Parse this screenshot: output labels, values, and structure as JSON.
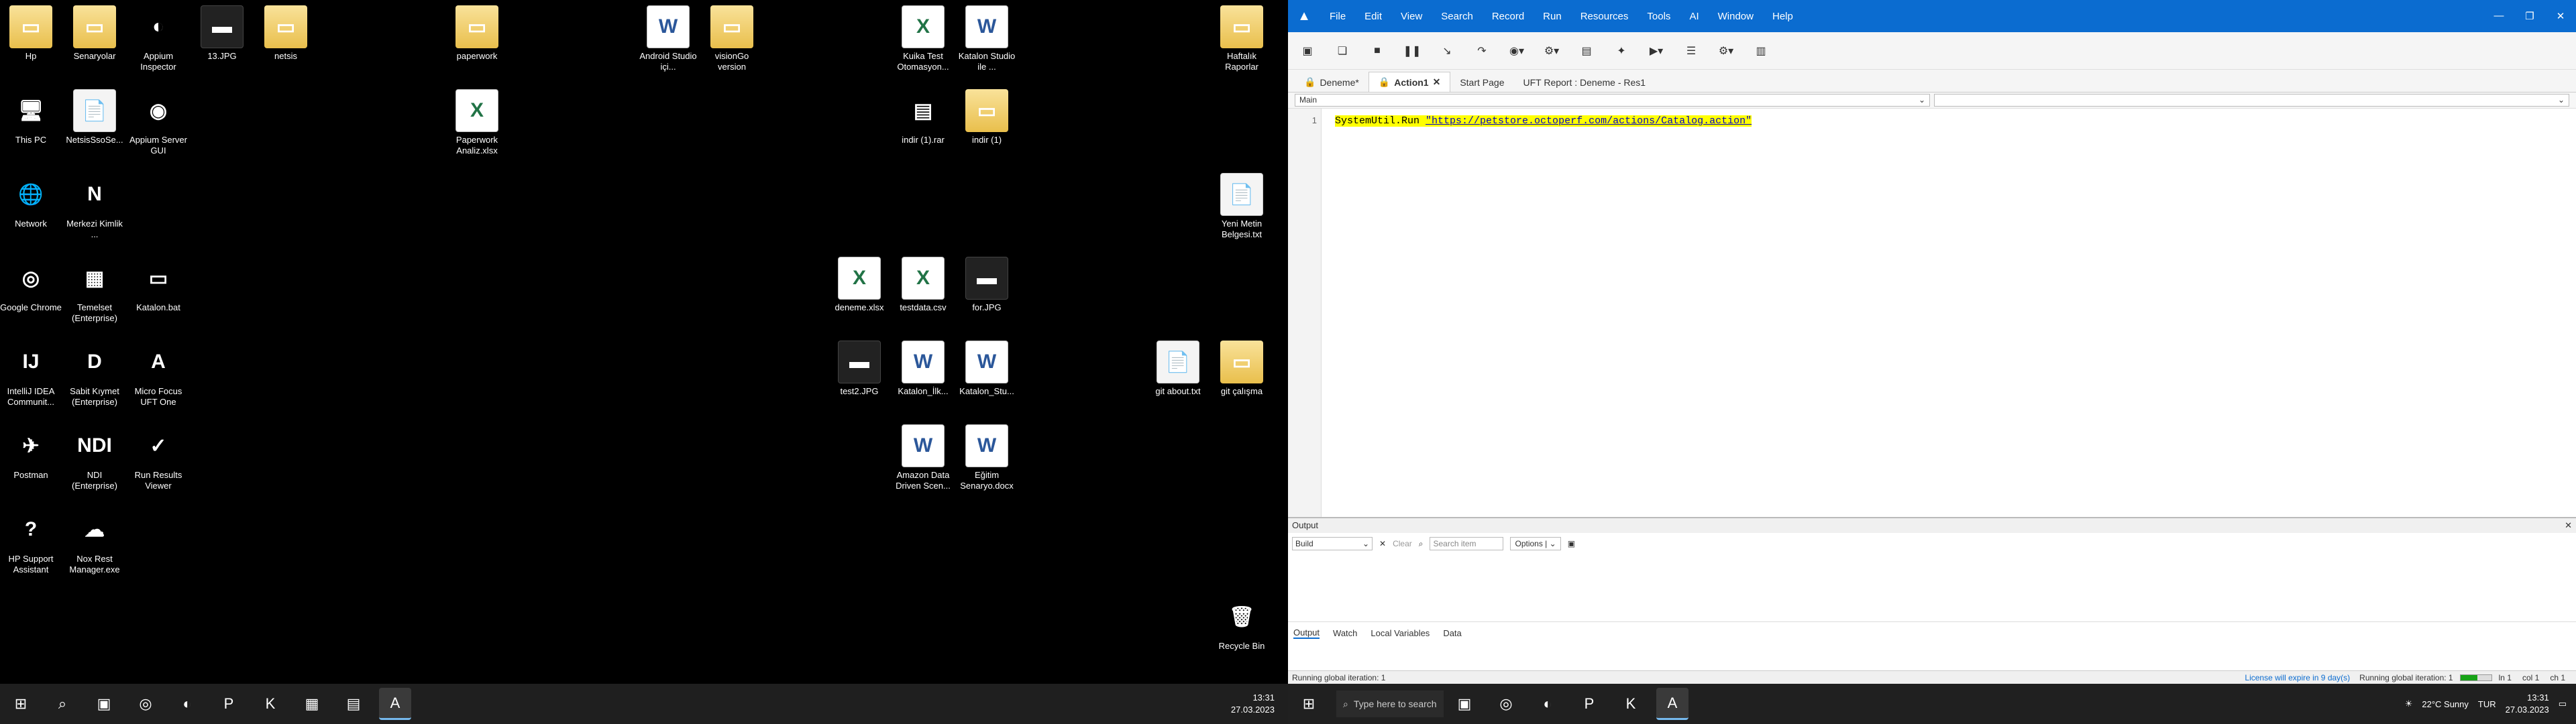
{
  "desktop_left": {
    "icons": [
      {
        "label": "Hp",
        "glyph": "▭"
      },
      {
        "label": "Senaryolar",
        "glyph": "▭"
      },
      {
        "label": "Appium Inspector",
        "glyph": "◐"
      },
      {
        "label": "13.JPG",
        "glyph": "▬"
      },
      {
        "label": "netsis",
        "glyph": "▭"
      },
      {
        "label": "paperwork",
        "glyph": "▭"
      },
      {
        "label": "Android Studio içi...",
        "glyph": "W"
      },
      {
        "label": "visionGo version",
        "glyph": "▭"
      },
      {
        "label": "Kuika Test Otomasyon...",
        "glyph": "X"
      },
      {
        "label": "Katalon Studio ile ...",
        "glyph": "W"
      },
      {
        "label": "Haftalık Raporlar",
        "glyph": "▭"
      },
      {
        "label": "This PC",
        "glyph": "🖥"
      },
      {
        "label": "NetsisSsoSe...",
        "glyph": "📄"
      },
      {
        "label": "Appium Server GUI",
        "glyph": "◉"
      },
      {
        "label": "Paperwork Analiz.xlsx",
        "glyph": "X"
      },
      {
        "label": "indir (1).rar",
        "glyph": "▤"
      },
      {
        "label": "indir (1)",
        "glyph": "▭"
      },
      {
        "label": "Network",
        "glyph": "🌐"
      },
      {
        "label": "Merkezi Kimlik ...",
        "glyph": "N"
      },
      {
        "label": "Yeni Metin Belgesi.txt",
        "glyph": "📄"
      },
      {
        "label": "Google Chrome",
        "glyph": "◎"
      },
      {
        "label": "Temelset (Enterprise)",
        "glyph": "▦"
      },
      {
        "label": "Katalon.bat",
        "glyph": "▭"
      },
      {
        "label": "deneme.xlsx",
        "glyph": "X"
      },
      {
        "label": "testdata.csv",
        "glyph": "X"
      },
      {
        "label": "for.JPG",
        "glyph": "▬"
      },
      {
        "label": "IntelliJ IDEA Communit...",
        "glyph": "IJ"
      },
      {
        "label": "Sabit Kıymet (Enterprise)",
        "glyph": "D"
      },
      {
        "label": "Micro Focus UFT One",
        "glyph": "A"
      },
      {
        "label": "test2.JPG",
        "glyph": "▬"
      },
      {
        "label": "Katalon_İlk...",
        "glyph": "W"
      },
      {
        "label": "Katalon_Stu...",
        "glyph": "W"
      },
      {
        "label": "git about.txt",
        "glyph": "📄"
      },
      {
        "label": "git çalışma",
        "glyph": "▭"
      },
      {
        "label": "Postman",
        "glyph": "✈"
      },
      {
        "label": "NDI (Enterprise)",
        "glyph": "NDI"
      },
      {
        "label": "Run Results Viewer",
        "glyph": "✓"
      },
      {
        "label": "Amazon Data Driven Scen...",
        "glyph": "W"
      },
      {
        "label": "Eğitim Senaryo.docx",
        "glyph": "W"
      },
      {
        "label": "HP Support Assistant",
        "glyph": "?"
      },
      {
        "label": "Nox Rest Manager.exe",
        "glyph": "☁"
      },
      {
        "label": "Recycle Bin",
        "glyph": "🗑"
      }
    ],
    "clock_time": "13:31",
    "clock_date": "27.03.2023"
  },
  "uft": {
    "menu": [
      "File",
      "Edit",
      "View",
      "Search",
      "Record",
      "Run",
      "Resources",
      "Tools",
      "AI",
      "Window",
      "Help"
    ],
    "tabs": [
      {
        "label": "Deneme*"
      },
      {
        "label": "Action1"
      },
      {
        "label": "Start Page"
      },
      {
        "label": "UFT Report : Deneme - Res1"
      }
    ],
    "doc_dropdown_left": "Main",
    "doc_dropdown_right": "",
    "code_line_number": "1",
    "code_prefix": "SystemUtil.Run ",
    "code_string": "\"https://petstore.octoperf.com/actions/Catalog.action\"",
    "output": {
      "title": "Output",
      "build_select": "Build",
      "clear_label": "Clear",
      "search_placeholder": "Search item",
      "options_label": "Options |"
    },
    "bottom_tabs": [
      "Output",
      "Watch",
      "Local Variables",
      "Data"
    ],
    "status": {
      "left": "Running global iteration: 1",
      "license": "License will expire in 9 day(s)",
      "right_iteration": "Running global iteration: 1",
      "ln": "ln 1",
      "col": "col 1",
      "ch": "ch 1",
      "progress": 0.55
    }
  },
  "taskbar_right": {
    "search_placeholder": "Type here to search",
    "weather": "22°C Sunny",
    "lang": "TUR",
    "time": "13:31",
    "date": "27.03.2023"
  }
}
